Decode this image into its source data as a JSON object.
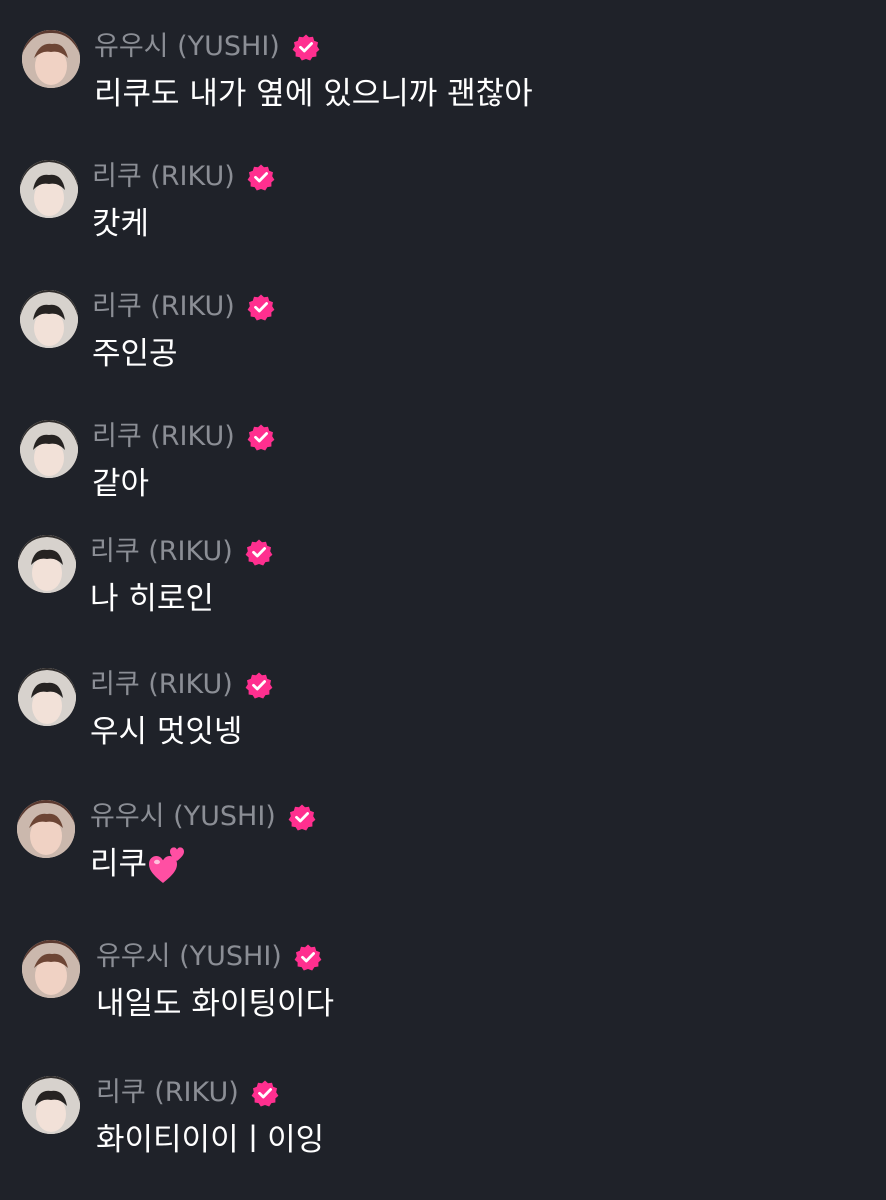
{
  "colors": {
    "background": "#1f2229",
    "name_text": "#8b8e95",
    "message_text": "#ffffff",
    "verified_badge": "#ff2f8f"
  },
  "messages": [
    {
      "sender": "유우시 (YUSHI)",
      "text": "리쿠도 내가 옆에 있으니까 괜찮아",
      "avatar": "yushi-avatar",
      "verified": true
    },
    {
      "sender": "리쿠 (RIKU)",
      "text": "캇케",
      "avatar": "riku-avatar",
      "verified": true
    },
    {
      "sender": "리쿠 (RIKU)",
      "text": "주인공",
      "avatar": "riku-avatar",
      "verified": true
    },
    {
      "sender": "리쿠 (RIKU)",
      "text": "같아",
      "avatar": "riku-avatar",
      "verified": true
    },
    {
      "sender": "리쿠 (RIKU)",
      "text": "나 히로인",
      "avatar": "riku-avatar",
      "verified": true
    },
    {
      "sender": "리쿠 (RIKU)",
      "text": "우시 멋잇넹",
      "avatar": "riku-avatar",
      "verified": true
    },
    {
      "sender": "유우시 (YUSHI)",
      "text": "리쿠",
      "emoji": "two-hearts",
      "avatar": "yushi-avatar",
      "verified": true
    },
    {
      "sender": "유우시 (YUSHI)",
      "text": "내일도 화이팅이다",
      "avatar": "yushi-avatar",
      "verified": true
    },
    {
      "sender": "리쿠 (RIKU)",
      "text": "화이티이이ㅣ이잉",
      "avatar": "riku-avatar",
      "verified": true
    }
  ]
}
